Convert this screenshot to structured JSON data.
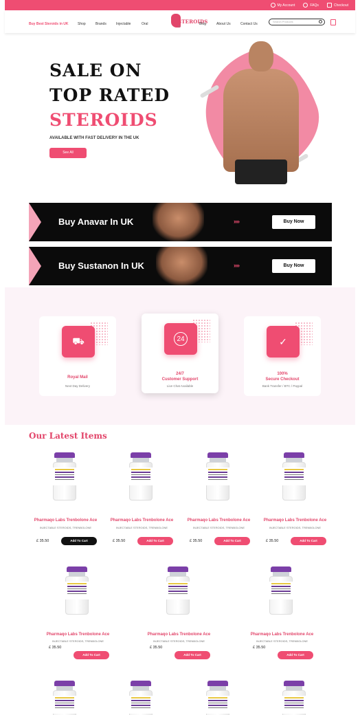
{
  "topbar": {
    "my_account": "My Account",
    "faqs": "FAQs",
    "checkout": "Checkout"
  },
  "nav": {
    "items": [
      "Buy Best Steroids in UK",
      "Shop",
      "Brands",
      "Injectable",
      "Oral",
      "Blog",
      "About Us",
      "Contact Us"
    ],
    "logo_text": "STEROIDS",
    "logo_sub": "UK",
    "search_placeholder": "Search Products"
  },
  "hero": {
    "line1": "SALE ON",
    "line2": "TOP RATED",
    "line3": "STEROIDS",
    "subtitle": "AVAILABLE WITH FAST DELIVERY IN THE UK",
    "button": "See All"
  },
  "banners": [
    {
      "title": "Buy Anavar In UK",
      "arrows": "»»",
      "button": "Buy Now"
    },
    {
      "title": "Buy Sustanon In UK",
      "arrows": "»»",
      "button": "Buy Now"
    }
  ],
  "features": [
    {
      "icon": "truck-icon",
      "glyph": "⛟",
      "title": "Royal Mail",
      "sub": "Next Day Delivery"
    },
    {
      "icon": "clock-24-icon",
      "glyph": "24",
      "title": "24/7\nCustomer Support",
      "sub": "Live Chat Available"
    },
    {
      "icon": "shield-check-icon",
      "glyph": "✓",
      "title": "100%\nSecure Checkout",
      "sub": "Bank Transfer / BTC / Paypal"
    }
  ],
  "latest_title": "Our Latest Items",
  "product": {
    "name": "Pharmaqo Labs Trenbolone Ace",
    "category": "INJECTABLE STEROIDS, TRENBOLONE",
    "price": "£ 35.50",
    "add_label": "Add To Cart"
  },
  "colors": {
    "accent": "#ef4d72",
    "dark": "#0b0b0b",
    "features_bg": "#fcf3f8"
  }
}
